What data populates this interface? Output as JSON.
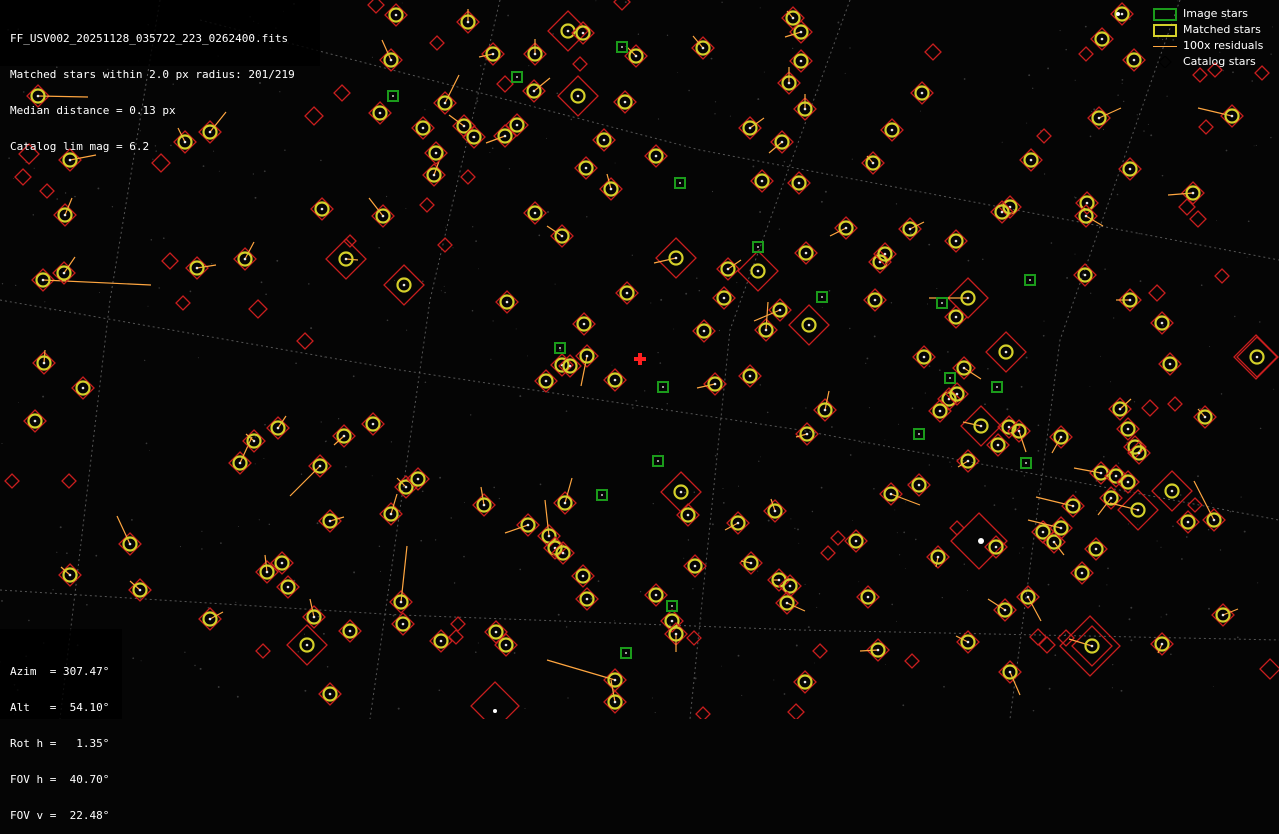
{
  "info": {
    "filename": "FF_USV002_20251128_035722_223_0262400.fits",
    "matched": "Matched stars within 2.0 px radius: 201/219",
    "median": "Median distance = 0.13 px",
    "limmag": "Catalog lim mag = 6.2"
  },
  "legend": {
    "image_stars": "Image stars",
    "matched_stars": "Matched stars",
    "residuals": "100x residuals",
    "catalog_stars": "Catalog stars"
  },
  "pointing": {
    "azim": "Azim  = 307.47°",
    "alt": "Alt   =  54.10°",
    "rot": "Rot h =   1.35°",
    "fovh": "FOV h =  40.70°",
    "fovv": "FOV v =  22.48°"
  },
  "colors": {
    "image": "#1b9a1b",
    "matched": "#d4d02a",
    "residual": "#ffa640",
    "catalog": "#c81e1e",
    "center": "#ff2020",
    "grid": "#8a8a8a"
  }
}
